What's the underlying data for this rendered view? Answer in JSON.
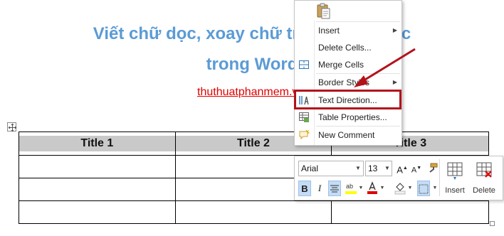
{
  "document": {
    "title_line1": "Viết chữ dọc, xoay chữ trong bảng dọc",
    "title_line2": "trong Word",
    "link_text": "thuthuatphanmem.vn",
    "table": {
      "headers": [
        "Title 1",
        "Title 2",
        "Title 3"
      ],
      "rows": [
        [
          "",
          "",
          ""
        ],
        [
          "",
          "",
          ""
        ],
        [
          "",
          "",
          ""
        ]
      ]
    }
  },
  "context_menu": {
    "items": [
      {
        "label": "Insert",
        "icon": "none",
        "submenu": true
      },
      {
        "label": "Delete Cells...",
        "icon": "none",
        "submenu": false
      },
      {
        "label": "Merge Cells",
        "icon": "merge-cells-icon",
        "submenu": false
      },
      {
        "label": "Border Styles",
        "icon": "none",
        "submenu": true
      },
      {
        "label": "Text Direction...",
        "icon": "text-direction-icon",
        "submenu": false,
        "highlighted": true
      },
      {
        "label": "Table Properties...",
        "icon": "table-properties-icon",
        "submenu": false
      },
      {
        "label": "New Comment",
        "icon": "new-comment-icon",
        "submenu": false
      }
    ],
    "highlight_color": "#b3121b"
  },
  "mini_toolbar": {
    "font_name": "Arial",
    "font_size": "13",
    "bold": "B",
    "italic": "I",
    "insert_label": "Insert",
    "delete_label": "Delete"
  },
  "colors": {
    "title": "#5b9bd5",
    "link": "#e00000",
    "header_fill": "#c9c9c9",
    "annotation": "#b3121b"
  }
}
